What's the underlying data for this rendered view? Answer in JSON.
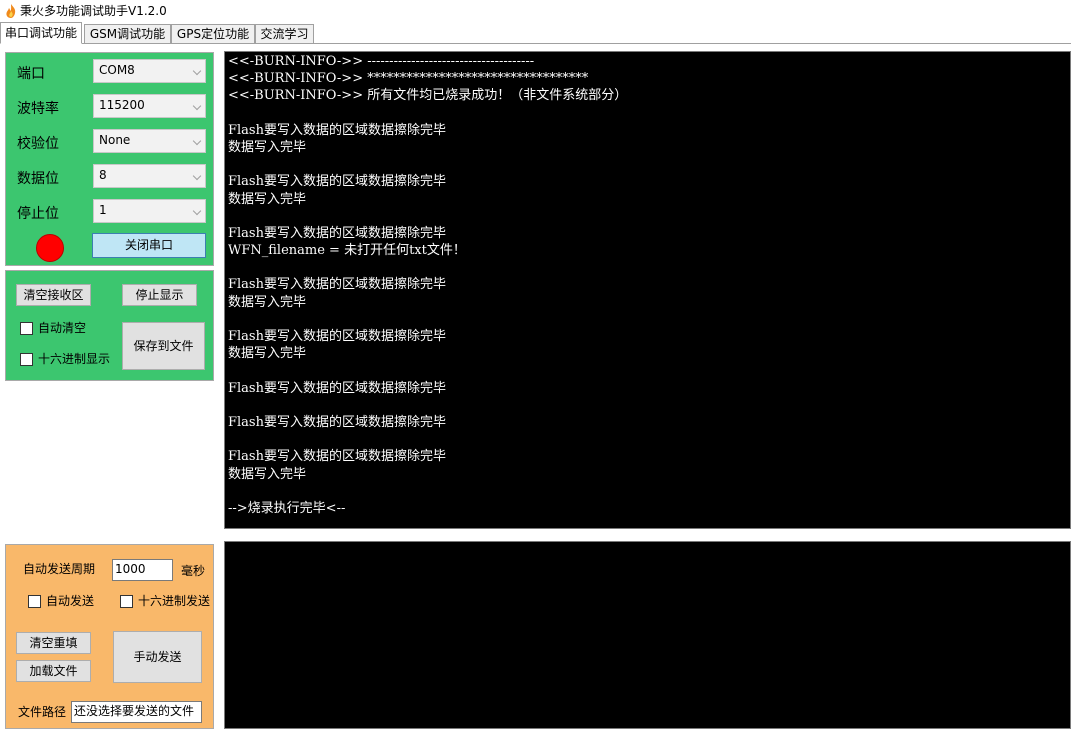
{
  "window": {
    "title": "秉火多功能调试助手V1.2.0",
    "icon": "fire-app-icon"
  },
  "tabs": [
    {
      "label": "串口调试功能",
      "active": true
    },
    {
      "label": "GSM调试功能"
    },
    {
      "label": "GPS定位功能"
    },
    {
      "label": "交流学习"
    }
  ],
  "serial": {
    "port_label": "端口",
    "port_value": "COM8",
    "baud_label": "波特率",
    "baud_value": "115200",
    "parity_label": "校验位",
    "parity_value": "None",
    "databits_label": "数据位",
    "databits_value": "8",
    "stopbits_label": "停止位",
    "stopbits_value": "1",
    "status_color": "#ff0000",
    "toggle_button": "关闭串口"
  },
  "receive": {
    "clear_button": "清空接收区",
    "stop_button": "停止显示",
    "auto_clear_label": "自动清空",
    "hex_display_label": "十六进制显示",
    "save_button": "保存到文件",
    "lines": [
      "<<-BURN-INFO->> --------------------------------------",
      "<<-BURN-INFO->> **********************************",
      "<<-BURN-INFO->> 所有文件均已烧录成功！（非文件系统部分）",
      "",
      "Flash要写入数据的区域数据擦除完毕",
      "数据写入完毕",
      "",
      "Flash要写入数据的区域数据擦除完毕",
      "数据写入完毕",
      "",
      "Flash要写入数据的区域数据擦除完毕",
      "WFN_filename = 未打开任何txt文件！",
      "",
      "Flash要写入数据的区域数据擦除完毕",
      "数据写入完毕",
      "",
      "Flash要写入数据的区域数据擦除完毕",
      "数据写入完毕",
      "",
      "Flash要写入数据的区域数据擦除完毕",
      "",
      "Flash要写入数据的区域数据擦除完毕",
      "",
      "Flash要写入数据的区域数据擦除完毕",
      "数据写入完毕",
      "",
      "-->烧录执行完毕<--"
    ]
  },
  "send": {
    "period_label": "自动发送周期",
    "period_value": "1000",
    "period_unit": "毫秒",
    "auto_send_label": "自动发送",
    "hex_send_label": "十六进制发送",
    "clear_button": "清空重填",
    "load_button": "加载文件",
    "manual_send_button": "手动发送",
    "path_label": "文件路径",
    "path_value": "还没选择要发送的文件"
  }
}
